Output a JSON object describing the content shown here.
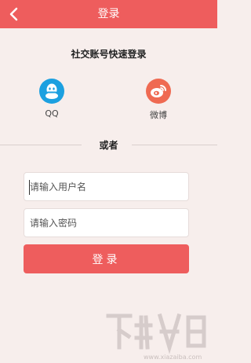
{
  "header": {
    "title": "登录"
  },
  "social": {
    "title": "社交账号快速登录",
    "qq_label": "QQ",
    "weibo_label": "微博"
  },
  "divider": {
    "text": "或者"
  },
  "form": {
    "username_placeholder": "请输入用户名",
    "password_placeholder": "请输入密码",
    "login_label": "登录"
  },
  "watermark": {
    "text": "www.xiazaiba.com"
  },
  "colors": {
    "primary": "#ee5d5d",
    "qq": "#1ca0e0",
    "weibo": "#ef6a52",
    "background": "#f7eeec"
  },
  "icons": {
    "back": "chevron-left-icon",
    "qq": "qq-penguin-icon",
    "weibo": "weibo-icon"
  }
}
